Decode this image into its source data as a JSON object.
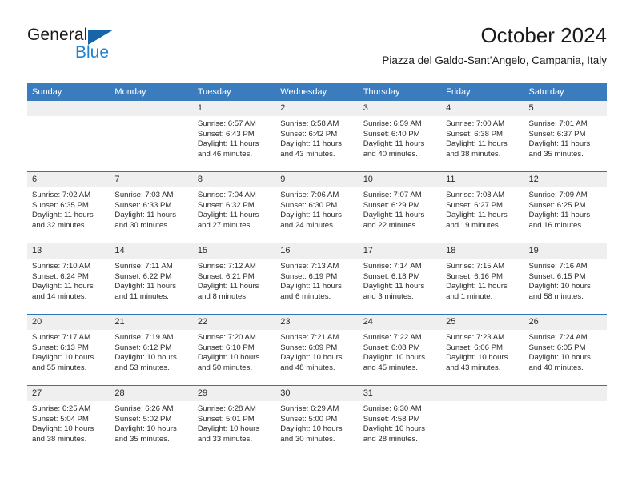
{
  "logo": {
    "word_primary": "General",
    "word_secondary": "Blue",
    "primary_color": "#1b1b1b",
    "secondary_color": "#2183d0",
    "triangle_color": "#1565a8"
  },
  "header": {
    "title": "October 2024",
    "subtitle": "Piazza del Galdo-Sant’Angelo, Campania, Italy"
  },
  "theme": {
    "header_row_bg": "#3a7cbe",
    "header_row_text": "#ffffff",
    "week_separator": "#2f76b8",
    "daynum_bg": "#efefef",
    "cell_bg": "#ffffff",
    "body_text": "#2b2b2b"
  },
  "calendar": {
    "weekday_headers": [
      "Sunday",
      "Monday",
      "Tuesday",
      "Wednesday",
      "Thursday",
      "Friday",
      "Saturday"
    ],
    "weeks": [
      [
        {
          "day": "",
          "empty": true
        },
        {
          "day": "",
          "empty": true
        },
        {
          "day": "1",
          "sunrise": "Sunrise: 6:57 AM",
          "sunset": "Sunset: 6:43 PM",
          "daylight": "Daylight: 11 hours and 46 minutes."
        },
        {
          "day": "2",
          "sunrise": "Sunrise: 6:58 AM",
          "sunset": "Sunset: 6:42 PM",
          "daylight": "Daylight: 11 hours and 43 minutes."
        },
        {
          "day": "3",
          "sunrise": "Sunrise: 6:59 AM",
          "sunset": "Sunset: 6:40 PM",
          "daylight": "Daylight: 11 hours and 40 minutes."
        },
        {
          "day": "4",
          "sunrise": "Sunrise: 7:00 AM",
          "sunset": "Sunset: 6:38 PM",
          "daylight": "Daylight: 11 hours and 38 minutes."
        },
        {
          "day": "5",
          "sunrise": "Sunrise: 7:01 AM",
          "sunset": "Sunset: 6:37 PM",
          "daylight": "Daylight: 11 hours and 35 minutes."
        }
      ],
      [
        {
          "day": "6",
          "sunrise": "Sunrise: 7:02 AM",
          "sunset": "Sunset: 6:35 PM",
          "daylight": "Daylight: 11 hours and 32 minutes."
        },
        {
          "day": "7",
          "sunrise": "Sunrise: 7:03 AM",
          "sunset": "Sunset: 6:33 PM",
          "daylight": "Daylight: 11 hours and 30 minutes."
        },
        {
          "day": "8",
          "sunrise": "Sunrise: 7:04 AM",
          "sunset": "Sunset: 6:32 PM",
          "daylight": "Daylight: 11 hours and 27 minutes."
        },
        {
          "day": "9",
          "sunrise": "Sunrise: 7:06 AM",
          "sunset": "Sunset: 6:30 PM",
          "daylight": "Daylight: 11 hours and 24 minutes."
        },
        {
          "day": "10",
          "sunrise": "Sunrise: 7:07 AM",
          "sunset": "Sunset: 6:29 PM",
          "daylight": "Daylight: 11 hours and 22 minutes."
        },
        {
          "day": "11",
          "sunrise": "Sunrise: 7:08 AM",
          "sunset": "Sunset: 6:27 PM",
          "daylight": "Daylight: 11 hours and 19 minutes."
        },
        {
          "day": "12",
          "sunrise": "Sunrise: 7:09 AM",
          "sunset": "Sunset: 6:25 PM",
          "daylight": "Daylight: 11 hours and 16 minutes."
        }
      ],
      [
        {
          "day": "13",
          "sunrise": "Sunrise: 7:10 AM",
          "sunset": "Sunset: 6:24 PM",
          "daylight": "Daylight: 11 hours and 14 minutes."
        },
        {
          "day": "14",
          "sunrise": "Sunrise: 7:11 AM",
          "sunset": "Sunset: 6:22 PM",
          "daylight": "Daylight: 11 hours and 11 minutes."
        },
        {
          "day": "15",
          "sunrise": "Sunrise: 7:12 AM",
          "sunset": "Sunset: 6:21 PM",
          "daylight": "Daylight: 11 hours and 8 minutes."
        },
        {
          "day": "16",
          "sunrise": "Sunrise: 7:13 AM",
          "sunset": "Sunset: 6:19 PM",
          "daylight": "Daylight: 11 hours and 6 minutes."
        },
        {
          "day": "17",
          "sunrise": "Sunrise: 7:14 AM",
          "sunset": "Sunset: 6:18 PM",
          "daylight": "Daylight: 11 hours and 3 minutes."
        },
        {
          "day": "18",
          "sunrise": "Sunrise: 7:15 AM",
          "sunset": "Sunset: 6:16 PM",
          "daylight": "Daylight: 11 hours and 1 minute."
        },
        {
          "day": "19",
          "sunrise": "Sunrise: 7:16 AM",
          "sunset": "Sunset: 6:15 PM",
          "daylight": "Daylight: 10 hours and 58 minutes."
        }
      ],
      [
        {
          "day": "20",
          "sunrise": "Sunrise: 7:17 AM",
          "sunset": "Sunset: 6:13 PM",
          "daylight": "Daylight: 10 hours and 55 minutes."
        },
        {
          "day": "21",
          "sunrise": "Sunrise: 7:19 AM",
          "sunset": "Sunset: 6:12 PM",
          "daylight": "Daylight: 10 hours and 53 minutes."
        },
        {
          "day": "22",
          "sunrise": "Sunrise: 7:20 AM",
          "sunset": "Sunset: 6:10 PM",
          "daylight": "Daylight: 10 hours and 50 minutes."
        },
        {
          "day": "23",
          "sunrise": "Sunrise: 7:21 AM",
          "sunset": "Sunset: 6:09 PM",
          "daylight": "Daylight: 10 hours and 48 minutes."
        },
        {
          "day": "24",
          "sunrise": "Sunrise: 7:22 AM",
          "sunset": "Sunset: 6:08 PM",
          "daylight": "Daylight: 10 hours and 45 minutes."
        },
        {
          "day": "25",
          "sunrise": "Sunrise: 7:23 AM",
          "sunset": "Sunset: 6:06 PM",
          "daylight": "Daylight: 10 hours and 43 minutes."
        },
        {
          "day": "26",
          "sunrise": "Sunrise: 7:24 AM",
          "sunset": "Sunset: 6:05 PM",
          "daylight": "Daylight: 10 hours and 40 minutes."
        }
      ],
      [
        {
          "day": "27",
          "sunrise": "Sunrise: 6:25 AM",
          "sunset": "Sunset: 5:04 PM",
          "daylight": "Daylight: 10 hours and 38 minutes."
        },
        {
          "day": "28",
          "sunrise": "Sunrise: 6:26 AM",
          "sunset": "Sunset: 5:02 PM",
          "daylight": "Daylight: 10 hours and 35 minutes."
        },
        {
          "day": "29",
          "sunrise": "Sunrise: 6:28 AM",
          "sunset": "Sunset: 5:01 PM",
          "daylight": "Daylight: 10 hours and 33 minutes."
        },
        {
          "day": "30",
          "sunrise": "Sunrise: 6:29 AM",
          "sunset": "Sunset: 5:00 PM",
          "daylight": "Daylight: 10 hours and 30 minutes."
        },
        {
          "day": "31",
          "sunrise": "Sunrise: 6:30 AM",
          "sunset": "Sunset: 4:58 PM",
          "daylight": "Daylight: 10 hours and 28 minutes."
        },
        {
          "day": "",
          "empty": true
        },
        {
          "day": "",
          "empty": true
        }
      ]
    ]
  }
}
